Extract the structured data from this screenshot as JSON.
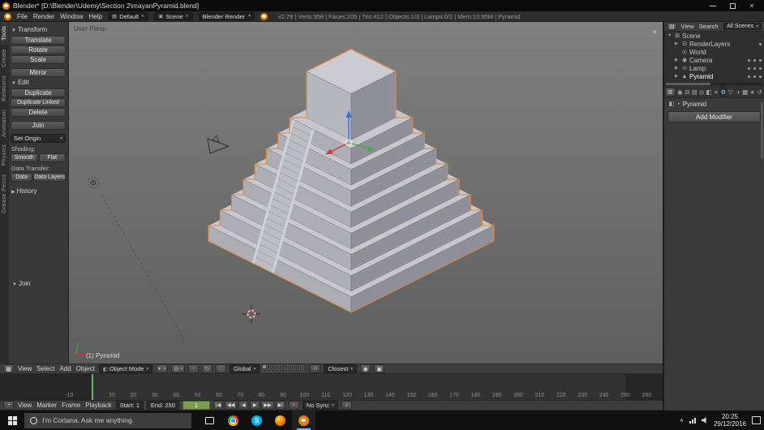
{
  "window": {
    "title": "Blender* [D:\\Blender\\Udemy\\Section 2\\mayanPyramid.blend]"
  },
  "info_bar": {
    "menus": [
      "File",
      "Render",
      "Window",
      "Help"
    ],
    "layout_name": "Default",
    "scene_name": "Scene",
    "engine": "Blender Render",
    "stats": "v2.78 | Verts:358 | Faces:205 | Tris:412 | Objects:1/3 | Lamps:0/1 | Mem:10.95M | Pyramid"
  },
  "tool_tabs": [
    {
      "label": "Tools",
      "active": true
    },
    {
      "label": "Create",
      "active": false
    },
    {
      "label": "Relations",
      "active": false
    },
    {
      "label": "Animation",
      "active": false
    },
    {
      "label": "Physics",
      "active": false
    },
    {
      "label": "Grease Pencil",
      "active": false
    }
  ],
  "tool_shelf": {
    "transform_title": "Transform",
    "translate": "Translate",
    "rotate": "Rotate",
    "scale": "Scale",
    "mirror": "Mirror",
    "edit_title": "Edit",
    "duplicate": "Duplicate",
    "duplicate_linked": "Duplicate Linked",
    "delete": "Delete",
    "join": "Join",
    "set_origin": "Set Origin",
    "shading_label": "Shading:",
    "smooth": "Smooth",
    "flat": "Flat",
    "data_transfer_label": "Data Transfer:",
    "data": "Data",
    "data_layers": "Data Layers",
    "history": "History",
    "redo_panel": "Join"
  },
  "viewport": {
    "view_label": "User Persp",
    "object_info": "(1) Pyramid"
  },
  "view3d_header": {
    "menus": [
      "View",
      "Select",
      "Add",
      "Object"
    ],
    "mode": "Object Mode",
    "orientation": "Global",
    "snap_target": "Closest"
  },
  "timeline": {
    "menus": [
      "View",
      "Marker",
      "Frame",
      "Playback"
    ],
    "start": "Start: 1",
    "end": "End: 250",
    "frame": "1",
    "sync": "No Sync",
    "ruler": [
      -10,
      10,
      20,
      30,
      40,
      50,
      60,
      70,
      80,
      90,
      100,
      110,
      120,
      130,
      140,
      150,
      160,
      170,
      180,
      190,
      200,
      210,
      220,
      230,
      240,
      250,
      260
    ],
    "playback": [
      "|◀",
      "◀◀",
      "◀",
      "▶",
      "▶▶",
      "▶|"
    ]
  },
  "outliner": {
    "menus": [
      "View",
      "Search"
    ],
    "filter": "All Scenes",
    "rows": [
      {
        "label": "Scene",
        "icon": "⊞"
      },
      {
        "label": "RenderLayers",
        "icon": "⊟"
      },
      {
        "label": "World",
        "icon": "◎"
      },
      {
        "label": "Camera",
        "icon": "◉"
      },
      {
        "label": "Lamp",
        "icon": "⊙"
      },
      {
        "label": "Pyramid",
        "icon": "▲"
      }
    ]
  },
  "properties": {
    "object_name": "Pyramid",
    "add_modifier": "Add Modifier"
  },
  "taskbar": {
    "cortana": "I'm Cortana. Ask me anything.",
    "time": "20:25",
    "date": "29/12/2016"
  },
  "icons": {
    "close": "×",
    "dropdown": "▾",
    "panel_open": "▼",
    "panel_closed": "▶",
    "plus": "+",
    "layout_field_icon": "▦",
    "scene_field_icon": "▣",
    "editor_3d": "▦",
    "editor_timeline": "◔",
    "editor_outliner": "▤",
    "editor_props": "▥",
    "mode_icon": "◧",
    "shading_mode": "◐",
    "pivot": "⊙",
    "manip_translate": "+",
    "manip_rotate": "↻",
    "manip_scale": "□",
    "magnet": "∩",
    "cam_button": "◉",
    "render_button": "▣",
    "record": "●",
    "speaker": "♪",
    "breadcrumb_obj": "◧",
    "breadcrumb_sep": "▸",
    "skype": "S",
    "props_tabs": [
      "◉",
      "⊟",
      "▤",
      "◎",
      "◧",
      "≡",
      "⚙",
      "▽",
      "◑",
      "▩",
      "∗",
      "↺"
    ]
  },
  "colors": {
    "selection_outline": "#e0873f",
    "current_frame": "#58c158",
    "axis_x": "#d03a3a",
    "axis_y": "#4da64d",
    "axis_z": "#3b6fde",
    "taskbar_active": "#76b9ed"
  }
}
